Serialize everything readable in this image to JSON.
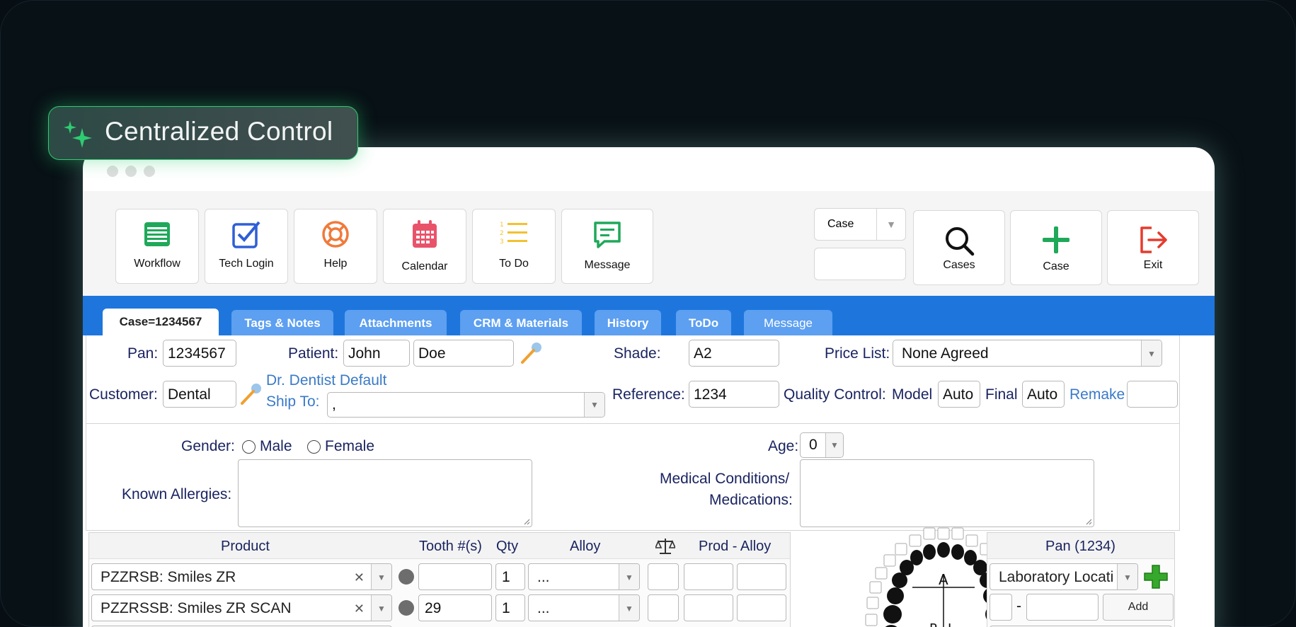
{
  "badge": {
    "label": "Centralized Control"
  },
  "toolbar": {
    "buttons": [
      {
        "label": "Workflow",
        "icon": "spreadsheet-icon"
      },
      {
        "label": "Tech Login",
        "icon": "checkbox-icon"
      },
      {
        "label": "Help",
        "icon": "lifebuoy-icon"
      },
      {
        "label": "Calendar",
        "icon": "calendar-icon"
      },
      {
        "label": "To Do",
        "icon": "numbered-list-icon"
      },
      {
        "label": "Message",
        "icon": "chat-icon"
      }
    ],
    "search_type": "Case",
    "search_value": "",
    "right_buttons": [
      {
        "label": "Cases",
        "icon": "search-icon"
      },
      {
        "label": "Case",
        "icon": "plus-icon"
      },
      {
        "label": "Exit",
        "icon": "exit-icon"
      }
    ]
  },
  "tabs": [
    "Case=1234567",
    "Tags & Notes",
    "Attachments",
    "CRM & Materials",
    "History",
    "ToDo",
    "Message"
  ],
  "case": {
    "pan_label": "Pan:",
    "pan": "1234567",
    "patient_label": "Patient:",
    "patient_first": "John",
    "patient_last": "Doe",
    "shade_label": "Shade:",
    "shade": "A2",
    "price_list_label": "Price List:",
    "price_list": "None Agreed",
    "customer_label": "Customer:",
    "customer": "Dental",
    "dentist_link": "Dr. Dentist Default",
    "ship_to_label": "Ship To:",
    "ship_to": ",",
    "reference_label": "Reference:",
    "reference": "1234",
    "qc_label": "Quality Control:",
    "model_label": "Model",
    "model": "Auto",
    "final_label": "Final",
    "final": "Auto",
    "remake_link": "Remake",
    "remake": ""
  },
  "patient_info": {
    "gender_label": "Gender:",
    "male": "Male",
    "female": "Female",
    "age_label": "Age:",
    "age": "0",
    "allergies_label": "Known Allergies:",
    "medical_label_1": "Medical Conditions/",
    "medical_label_2": "Medications:"
  },
  "products": {
    "headers": {
      "product": "Product",
      "tooth": "Tooth #(s)",
      "qty": "Qty",
      "alloy": "Alloy",
      "prod_alloy": "Prod - Alloy"
    },
    "rows": [
      {
        "product": "PZZRSB: Smiles ZR",
        "tooth": "",
        "qty": "1",
        "alloy": "..."
      },
      {
        "product": "PZZRSSB: Smiles ZR SCAN",
        "tooth": "29",
        "qty": "1",
        "alloy": "..."
      }
    ]
  },
  "tooth_chart": {
    "arch": "A",
    "right": "R",
    "left": "L"
  },
  "pan_panel": {
    "title": "Pan (1234)",
    "location": "Laboratory Locati",
    "dash": "-",
    "add_label": "Add"
  },
  "colors": {
    "tab_bar": "#1e76dd",
    "tab_inactive": "#5d9ff0",
    "badge_border": "#2ecc71",
    "label": "#1a2460",
    "link": "#3a7ac7"
  }
}
